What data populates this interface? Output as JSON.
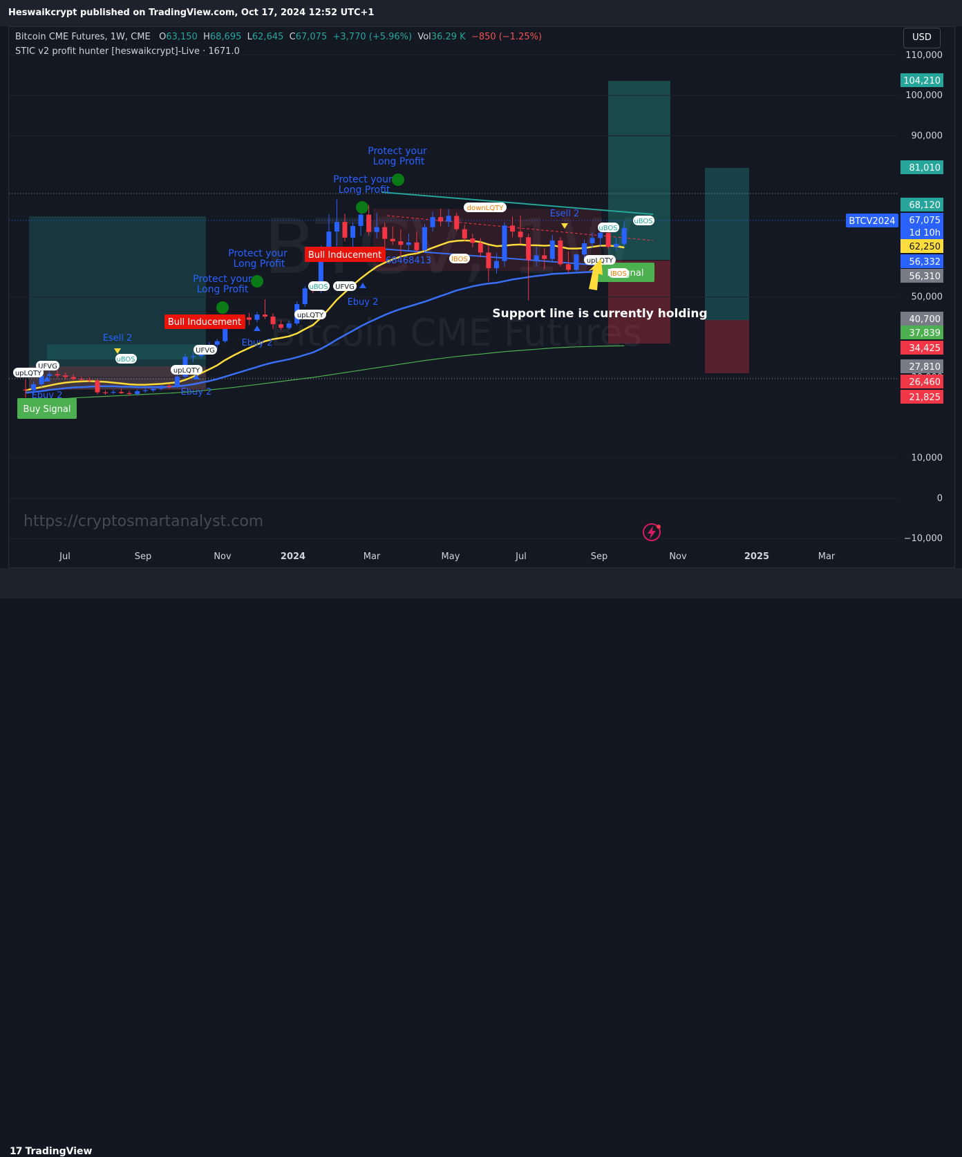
{
  "header": {
    "published": "Heswaikcrypt published on TradingView.com, Oct 17, 2024 12:52 UTC+1"
  },
  "legend": {
    "title": "Bitcoin CME Futures, 1W, CME",
    "o_label": "O",
    "o": "63,150",
    "h_label": "H",
    "h": "68,695",
    "l_label": "L",
    "l": "62,645",
    "c_label": "C",
    "c": "67,075",
    "change": "+3,770 (+5.96%)",
    "vol_label": "Vol",
    "vol": "36.29 K",
    "vol_change": "−850 (−1.25%)",
    "indicator": "STIC v2 profit hunter [heswaikcrypt]-Live · 1671.0"
  },
  "currency_button": "USD",
  "watermark": {
    "url": "https://cryptosmartanalyst.com",
    "symbol": "BTCV2024",
    "symbol_display": "BTCV, 1W",
    "name": "Bitcoin CME Futures"
  },
  "footer": {
    "logo_mark": "17",
    "brand": "TradingView"
  },
  "annotation": "Support line is currently holding",
  "colors": {
    "up": "#2962ff",
    "down": "#f23645",
    "ema_fast": "#fddc3c",
    "ema_slow": "#3a6ff7",
    "ema_long": "#4caf50",
    "accent_green": "#26a69a",
    "accent_red": "#f23645"
  },
  "chart_data": {
    "type": "candlestick",
    "symbol": "BTCV2024",
    "interval": "1W",
    "ylim": [
      -17000,
      117000
    ],
    "y_ticks": [
      "110,000",
      "100,000",
      "90,000",
      "50,000",
      "30,000",
      "10,000",
      "0",
      "−10,000"
    ],
    "x_ticks": [
      "Jul",
      "Sep",
      "Nov",
      "2024",
      "Mar",
      "May",
      "Jul",
      "Sep",
      "Nov",
      "2025",
      "Mar"
    ],
    "x_ticks_bold": [
      "2024",
      "2025"
    ],
    "price_labels": [
      {
        "text": "104,210",
        "color": "#26a69a"
      },
      {
        "text": "81,010",
        "color": "#26a69a"
      },
      {
        "text": "68,120",
        "color": "#26a69a"
      },
      {
        "text": "67,075",
        "color": "#2962ff"
      },
      {
        "text": "1d 10h",
        "color": "#2962ff"
      },
      {
        "text": "62,250",
        "color": "#fddc3c"
      },
      {
        "text": "56,332",
        "color": "#2962ff"
      },
      {
        "text": "56,310",
        "color": "#787b86"
      },
      {
        "text": "40,700",
        "color": "#787b86"
      },
      {
        "text": "37,839",
        "color": "#4caf50"
      },
      {
        "text": "34,425",
        "color": "#f23645"
      },
      {
        "text": "27,810",
        "color": "#787b86"
      },
      {
        "text": "26,460",
        "color": "#f23645"
      },
      {
        "text": "21,825",
        "color": "#f23645"
      }
    ],
    "symbol_tag": "BTCV2024",
    "candles": [
      {
        "o": 27000,
        "h": 29500,
        "l": 25000,
        "c": 26800
      },
      {
        "o": 26800,
        "h": 29000,
        "l": 26000,
        "c": 28300
      },
      {
        "o": 28300,
        "h": 31200,
        "l": 27500,
        "c": 30400
      },
      {
        "o": 30400,
        "h": 31500,
        "l": 29500,
        "c": 30800
      },
      {
        "o": 30800,
        "h": 31800,
        "l": 29800,
        "c": 30500
      },
      {
        "o": 30500,
        "h": 31200,
        "l": 29600,
        "c": 30100
      },
      {
        "o": 30100,
        "h": 30800,
        "l": 29300,
        "c": 29600
      },
      {
        "o": 29600,
        "h": 30200,
        "l": 29100,
        "c": 29400
      },
      {
        "o": 29400,
        "h": 30100,
        "l": 28800,
        "c": 29200
      },
      {
        "o": 29200,
        "h": 29700,
        "l": 25800,
        "c": 26300
      },
      {
        "o": 26300,
        "h": 26800,
        "l": 25700,
        "c": 26200
      },
      {
        "o": 26200,
        "h": 26900,
        "l": 25800,
        "c": 26400
      },
      {
        "o": 26400,
        "h": 27200,
        "l": 25900,
        "c": 26100
      },
      {
        "o": 26100,
        "h": 26700,
        "l": 25400,
        "c": 25900
      },
      {
        "o": 25900,
        "h": 27000,
        "l": 25500,
        "c": 26600
      },
      {
        "o": 26600,
        "h": 27300,
        "l": 26200,
        "c": 26800
      },
      {
        "o": 26800,
        "h": 27600,
        "l": 26300,
        "c": 27200
      },
      {
        "o": 27200,
        "h": 28000,
        "l": 26800,
        "c": 27900
      },
      {
        "o": 27900,
        "h": 28400,
        "l": 27200,
        "c": 27600
      },
      {
        "o": 27600,
        "h": 30800,
        "l": 27400,
        "c": 30200
      },
      {
        "o": 30200,
        "h": 35800,
        "l": 29800,
        "c": 35100
      },
      {
        "o": 35100,
        "h": 36200,
        "l": 33800,
        "c": 35300
      },
      {
        "o": 35300,
        "h": 38200,
        "l": 34800,
        "c": 37600
      },
      {
        "o": 37600,
        "h": 38800,
        "l": 36400,
        "c": 38100
      },
      {
        "o": 38100,
        "h": 39600,
        "l": 37000,
        "c": 39000
      },
      {
        "o": 39000,
        "h": 45500,
        "l": 38500,
        "c": 44600
      },
      {
        "o": 44600,
        "h": 45600,
        "l": 42200,
        "c": 43800
      },
      {
        "o": 43800,
        "h": 45300,
        "l": 42800,
        "c": 44900
      },
      {
        "o": 44900,
        "h": 46000,
        "l": 43000,
        "c": 44300
      },
      {
        "o": 44300,
        "h": 46300,
        "l": 43700,
        "c": 45600
      },
      {
        "o": 45600,
        "h": 49400,
        "l": 44500,
        "c": 45100
      },
      {
        "o": 45100,
        "h": 45900,
        "l": 42000,
        "c": 43200
      },
      {
        "o": 43200,
        "h": 44200,
        "l": 41800,
        "c": 42300
      },
      {
        "o": 42300,
        "h": 44100,
        "l": 41900,
        "c": 43400
      },
      {
        "o": 43400,
        "h": 48900,
        "l": 42900,
        "c": 48200
      },
      {
        "o": 48200,
        "h": 52600,
        "l": 47500,
        "c": 52100
      },
      {
        "o": 52100,
        "h": 52800,
        "l": 50900,
        "c": 51600
      },
      {
        "o": 51600,
        "h": 62800,
        "l": 51000,
        "c": 62100
      },
      {
        "o": 62100,
        "h": 70500,
        "l": 60500,
        "c": 66200
      },
      {
        "o": 66200,
        "h": 74200,
        "l": 62600,
        "c": 68600
      },
      {
        "o": 68600,
        "h": 70600,
        "l": 63800,
        "c": 64700
      },
      {
        "o": 64700,
        "h": 68500,
        "l": 60900,
        "c": 67600
      },
      {
        "o": 67600,
        "h": 72400,
        "l": 65100,
        "c": 70400
      },
      {
        "o": 70400,
        "h": 72800,
        "l": 65200,
        "c": 66100
      },
      {
        "o": 66100,
        "h": 70900,
        "l": 64500,
        "c": 67300
      },
      {
        "o": 67300,
        "h": 68400,
        "l": 61200,
        "c": 64400
      },
      {
        "o": 64400,
        "h": 67500,
        "l": 62900,
        "c": 63800
      },
      {
        "o": 63800,
        "h": 66800,
        "l": 59100,
        "c": 62900
      },
      {
        "o": 62900,
        "h": 65700,
        "l": 61600,
        "c": 63500
      },
      {
        "o": 63500,
        "h": 66200,
        "l": 60800,
        "c": 61600
      },
      {
        "o": 61600,
        "h": 68100,
        "l": 60900,
        "c": 67300
      },
      {
        "o": 67300,
        "h": 71200,
        "l": 66200,
        "c": 69800
      },
      {
        "o": 69800,
        "h": 71900,
        "l": 67500,
        "c": 68700
      },
      {
        "o": 68700,
        "h": 71800,
        "l": 67400,
        "c": 70100
      },
      {
        "o": 70100,
        "h": 70900,
        "l": 66300,
        "c": 66800
      },
      {
        "o": 66800,
        "h": 67900,
        "l": 63800,
        "c": 64500
      },
      {
        "o": 64500,
        "h": 65700,
        "l": 62300,
        "c": 63400
      },
      {
        "o": 63400,
        "h": 64600,
        "l": 59800,
        "c": 61000
      },
      {
        "o": 61000,
        "h": 62800,
        "l": 53800,
        "c": 57100
      },
      {
        "o": 57100,
        "h": 60900,
        "l": 55800,
        "c": 58900
      },
      {
        "o": 58900,
        "h": 68500,
        "l": 57500,
        "c": 67700
      },
      {
        "o": 67700,
        "h": 69900,
        "l": 64800,
        "c": 66200
      },
      {
        "o": 66200,
        "h": 70200,
        "l": 63100,
        "c": 64800
      },
      {
        "o": 64800,
        "h": 65600,
        "l": 49100,
        "c": 59100
      },
      {
        "o": 59100,
        "h": 62500,
        "l": 57600,
        "c": 60300
      },
      {
        "o": 60300,
        "h": 62100,
        "l": 56900,
        "c": 59400
      },
      {
        "o": 59400,
        "h": 65400,
        "l": 58500,
        "c": 64000
      },
      {
        "o": 64000,
        "h": 64900,
        "l": 57600,
        "c": 58100
      },
      {
        "o": 58100,
        "h": 61300,
        "l": 55900,
        "c": 56700
      },
      {
        "o": 56700,
        "h": 60800,
        "l": 56100,
        "c": 60500
      },
      {
        "o": 60500,
        "h": 64200,
        "l": 59700,
        "c": 63300
      },
      {
        "o": 63300,
        "h": 65900,
        "l": 62100,
        "c": 64600
      },
      {
        "o": 64600,
        "h": 66500,
        "l": 62400,
        "c": 65900
      },
      {
        "o": 65900,
        "h": 66700,
        "l": 61800,
        "c": 62400
      },
      {
        "o": 62400,
        "h": 64700,
        "l": 61500,
        "c": 63150
      },
      {
        "o": 63150,
        "h": 68695,
        "l": 62645,
        "c": 67075
      }
    ],
    "series": [
      {
        "values": [
          26800,
          27200,
          27600,
          28000,
          28400,
          28700,
          28900,
          29000,
          29100,
          29000,
          28900,
          28700,
          28500,
          28300,
          28200,
          28200,
          28300,
          28400,
          28600,
          28800,
          29400,
          30200,
          31100,
          32000,
          33000,
          34300,
          35400,
          36400,
          37300,
          38200,
          39000,
          39500,
          39800,
          40200,
          40900,
          42000,
          43000,
          44800,
          47000,
          49300,
          51100,
          52900,
          54600,
          56100,
          57500,
          58500,
          59300,
          60000,
          60500,
          60800,
          61400,
          62200,
          62900,
          63600,
          63900,
          64000,
          63900,
          63600,
          63000,
          62600,
          62700,
          62900,
          63000,
          62800,
          62800,
          62700,
          62800,
          62400,
          62000,
          62000,
          62100,
          62400,
          62700,
          62700,
          62600,
          62250
        ]
      },
      {
        "values": [
          26200,
          26400,
          26600,
          26900,
          27100,
          27300,
          27500,
          27600,
          27700,
          27800,
          27800,
          27800,
          27700,
          27700,
          27600,
          27600,
          27600,
          27600,
          27700,
          27800,
          28000,
          28300,
          28700,
          29100,
          29600,
          30200,
          30800,
          31400,
          32000,
          32600,
          33200,
          33700,
          34100,
          34500,
          35000,
          35600,
          36200,
          37100,
          38200,
          39400,
          40500,
          41600,
          42700,
          43700,
          44600,
          45500,
          46300,
          47000,
          47600,
          48200,
          48800,
          49500,
          50200,
          50900,
          51600,
          52100,
          52600,
          53000,
          53300,
          53500,
          53900,
          54300,
          54600,
          54900,
          55200,
          55400,
          55700,
          55800,
          55900,
          56000,
          56100,
          56200,
          56300,
          56300,
          56300,
          56332
        ]
      },
      {
        "values": [
          24000,
          24150,
          24300,
          24450,
          24600,
          24750,
          24900,
          25000,
          25100,
          25200,
          25300,
          25400,
          25500,
          25600,
          25700,
          25800,
          25900,
          26000,
          26100,
          26200,
          26350,
          26500,
          26700,
          26900,
          27100,
          27300,
          27500,
          27750,
          28000,
          28250,
          28500,
          28750,
          29000,
          29250,
          29500,
          29750,
          30000,
          30300,
          30600,
          30900,
          31200,
          31500,
          31800,
          32100,
          32400,
          32700,
          33000,
          33300,
          33600,
          33900,
          34200,
          34450,
          34700,
          34950,
          35200,
          35400,
          35600,
          35800,
          36000,
          36200,
          36400,
          36550,
          36700,
          36850,
          37000,
          37150,
          37300,
          37400,
          37500,
          37600,
          37650,
          37700,
          37750,
          37800,
          37820,
          37839
        ]
      }
    ],
    "labels": [
      "Buy Signal",
      "Bull Inducement",
      "Bull Inducement",
      "B Signal",
      "Protect your",
      "Long Profit",
      "Ebuy 2",
      "Esell 2",
      "uBOS",
      "UFVG",
      "upLQTY",
      "lBOS",
      "downLQTY",
      "68468413"
    ]
  }
}
